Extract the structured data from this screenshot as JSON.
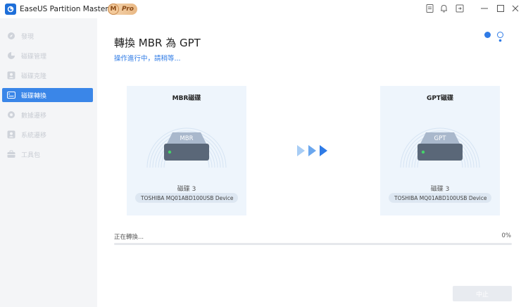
{
  "titlebar": {
    "app_title": "EaseUS Partition Master 專業版",
    "pro_badge_letter": "M",
    "pro_badge_text": "Pro",
    "icons": [
      "notes-icon",
      "bell-icon",
      "export-icon",
      "minimize-icon",
      "maximize-icon",
      "close-icon"
    ]
  },
  "sidebar": {
    "items": [
      {
        "label": "發現",
        "icon": "discover-icon",
        "active": false
      },
      {
        "label": "磁碟管理",
        "icon": "pie-chart-icon",
        "active": false
      },
      {
        "label": "磁碟克隆",
        "icon": "user-icon",
        "active": false
      },
      {
        "label": "磁碟轉換",
        "icon": "disk-convert-icon",
        "active": true
      },
      {
        "label": "數據遷移",
        "icon": "migrate-icon",
        "active": false
      },
      {
        "label": "系統遷移",
        "icon": "system-icon",
        "active": false
      },
      {
        "label": "工具包",
        "icon": "toolkit-icon",
        "active": false
      }
    ]
  },
  "main": {
    "title": "轉換 MBR 為 GPT",
    "subtitle": "操作進行中，請稍等...",
    "source": {
      "card_title": "MBR磁碟",
      "disk_badge": "MBR",
      "disk_name": "磁碟 3",
      "model": "TOSHIBA  MQ01ABD100",
      "type": "USB Device"
    },
    "target": {
      "card_title": "GPT磁碟",
      "disk_badge": "GPT",
      "disk_name": "磁碟 3",
      "model": "TOSHIBA  MQ01ABD100",
      "type": "USB Device"
    },
    "progress": {
      "label": "正在轉換...",
      "percent_text": "0%",
      "value": 0
    },
    "stop_label": "中止"
  },
  "colors": {
    "accent": "#2f7be6",
    "sidebar_active": "#3a86e8",
    "card_bg": "#eef5fc"
  }
}
